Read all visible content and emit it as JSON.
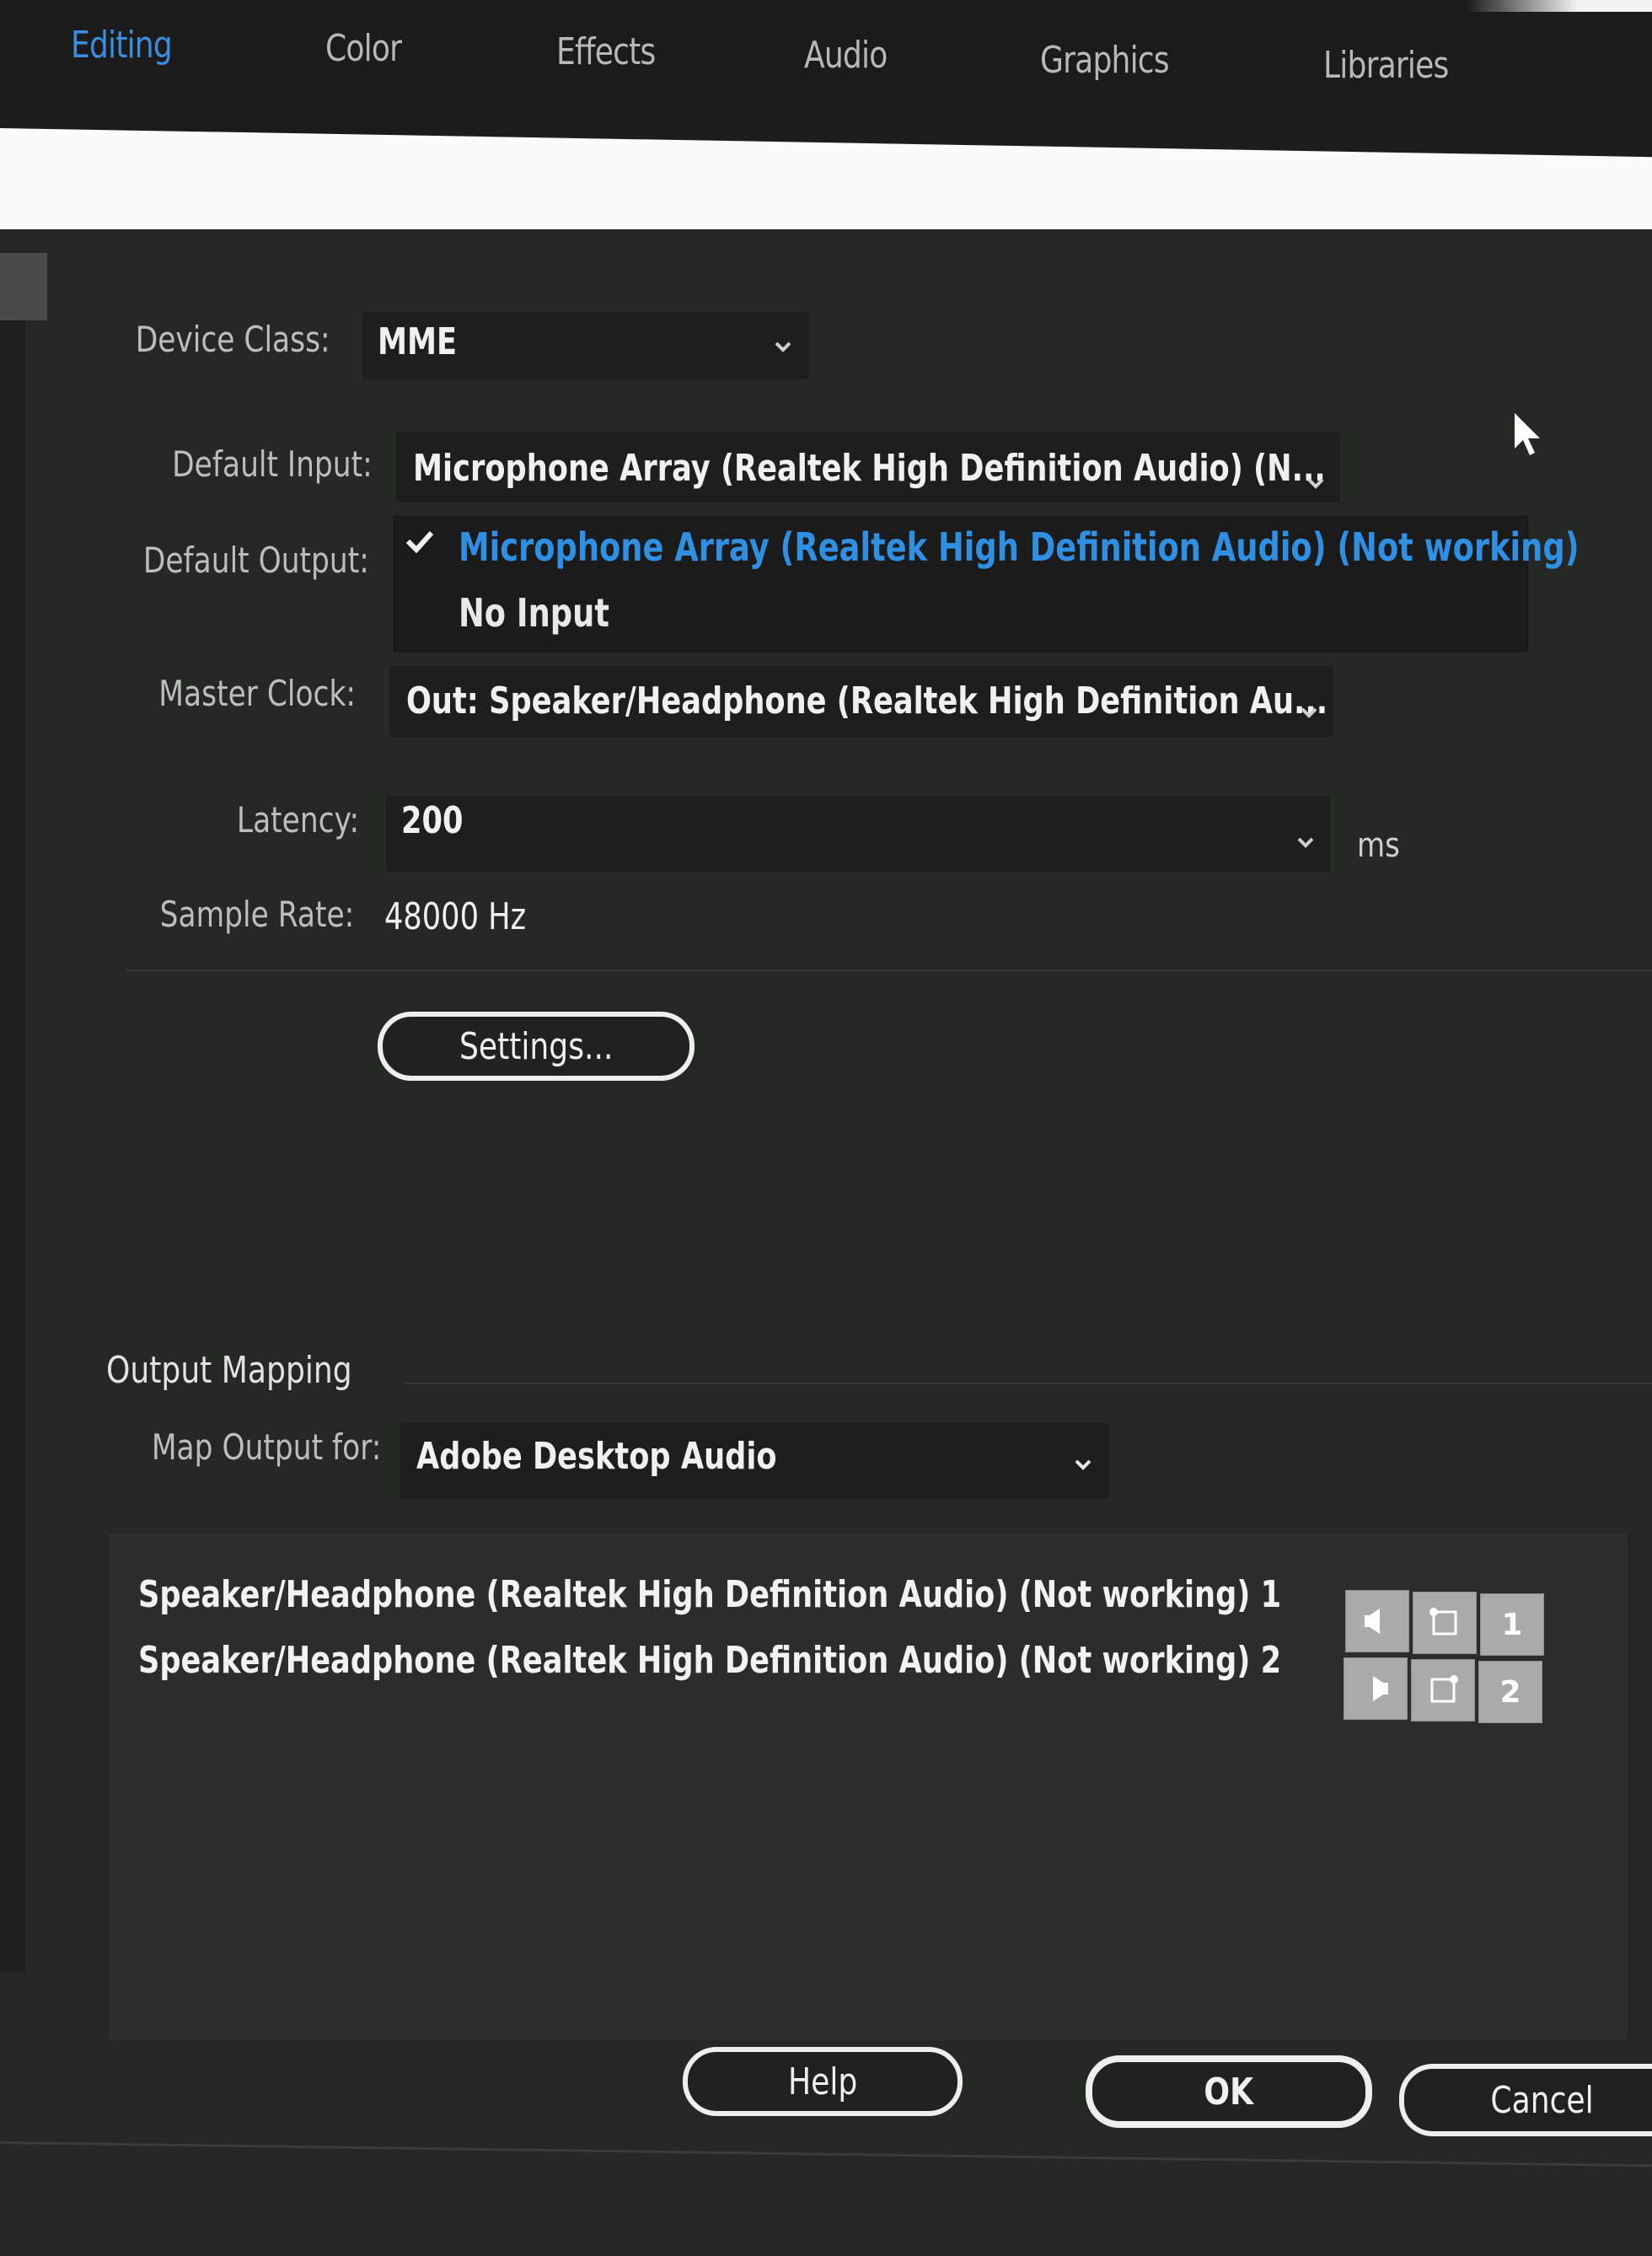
{
  "workspace_tabs": [
    {
      "label": "Editing",
      "active": true
    },
    {
      "label": "Color",
      "active": false
    },
    {
      "label": "Effects",
      "active": false
    },
    {
      "label": "Audio",
      "active": false
    },
    {
      "label": "Graphics",
      "active": false
    },
    {
      "label": "Libraries",
      "active": false
    }
  ],
  "colors": {
    "accent": "#2f8fe3",
    "dialog_bg": "#262826",
    "text": "#f0f0f0"
  },
  "audio_hardware": {
    "device_class": {
      "label": "Device Class:",
      "value": "MME"
    },
    "default_input": {
      "label": "Default Input:",
      "value": "Microphone Array (Realtek High Definition Audio) (N..."
    },
    "default_output": {
      "label": "Default Output:"
    },
    "input_dropdown": {
      "options": [
        {
          "label": "Microphone Array (Realtek High Definition Audio) (Not working)",
          "selected": true
        },
        {
          "label": "No Input",
          "selected": false
        }
      ]
    },
    "master_clock": {
      "label": "Master Clock:",
      "value": "Out: Speaker/Headphone (Realtek High Definition Au..."
    },
    "latency": {
      "label": "Latency:",
      "value": "200",
      "unit": "ms"
    },
    "sample_rate": {
      "label": "Sample Rate:",
      "value": "48000 Hz"
    },
    "settings_button": "Settings..."
  },
  "output_mapping": {
    "title": "Output Mapping",
    "map_output_for": {
      "label": "Map Output for:",
      "value": "Adobe Desktop Audio"
    },
    "channels": [
      {
        "label": "Speaker/Headphone (Realtek High Definition Audio) (Not working) 1",
        "number": "1",
        "side": "left"
      },
      {
        "label": "Speaker/Headphone (Realtek High Definition Audio) (Not working) 2",
        "number": "2",
        "side": "right"
      }
    ]
  },
  "footer": {
    "help": "Help",
    "ok": "OK",
    "cancel": "Cancel"
  }
}
